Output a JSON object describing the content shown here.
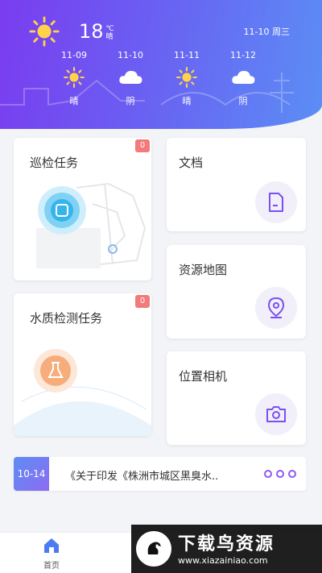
{
  "weather": {
    "today": {
      "temperature": "18",
      "unit": "℃",
      "condition": "晴",
      "icon": "sun-icon"
    },
    "date_label": "11-10 周三",
    "forecast": [
      {
        "date": "11-09",
        "condition": "晴",
        "icon": "sun-icon"
      },
      {
        "date": "11-10",
        "condition": "阴",
        "icon": "cloud-icon"
      },
      {
        "date": "11-11",
        "condition": "晴",
        "icon": "sun-icon"
      },
      {
        "date": "11-12",
        "condition": "阴",
        "icon": "cloud-icon"
      }
    ]
  },
  "cards": {
    "patrol": {
      "title": "巡检任务",
      "badge": "0",
      "icon": "patrol-map-icon"
    },
    "water": {
      "title": "水质检测任务",
      "badge": "0",
      "icon": "flask-icon"
    },
    "docs": {
      "title": "文档",
      "icon": "document-icon"
    },
    "resource_map": {
      "title": "资源地图",
      "icon": "map-pin-icon"
    },
    "camera": {
      "title": "位置相机",
      "icon": "camera-icon"
    }
  },
  "notice": {
    "date": "10-14",
    "text": "《关于印发《株洲市城区黑臭水..",
    "more_icon": "more-dots-icon"
  },
  "bottom_nav": {
    "home_label": "首页",
    "home_icon": "home-icon"
  },
  "watermark": {
    "title": "下载鸟资源",
    "url": "www.xiazainiao.com"
  },
  "colors": {
    "accent": "#7b4ff0",
    "badge": "#f37a7a",
    "header_start": "#7a3cf0",
    "header_end": "#5b8ef5"
  }
}
